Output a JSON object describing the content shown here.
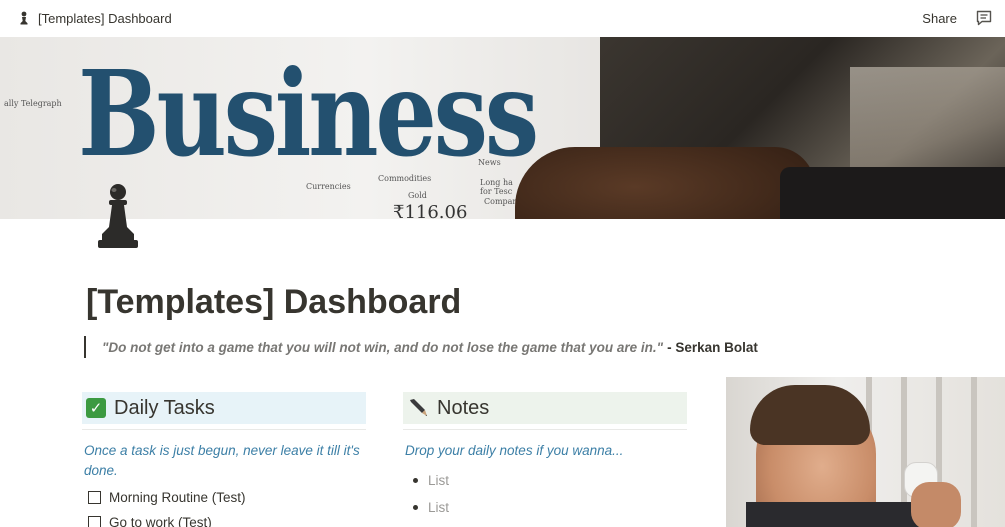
{
  "topbar": {
    "breadcrumb": "[Templates] Dashboard",
    "share_label": "Share"
  },
  "cover": {
    "headline": "Business",
    "paper_labels": [
      "ally Telegraph",
      "Currencies",
      "Commodities",
      "News",
      "Long ha",
      "for Tesc",
      "Compan",
      "Gold"
    ],
    "price": "₹116.06"
  },
  "page": {
    "title": "[Templates] Dashboard",
    "quote_text": "\"Do not get into a game that you will not win, and do not lose the game that you are in.\"",
    "quote_author": "- Serkan Bolat"
  },
  "daily_tasks": {
    "heading": "Daily Tasks",
    "subtitle": "Once a task is just begun, never leave it till it's done.",
    "items": [
      "Morning Routine (Test)",
      "Go to work (Test)"
    ]
  },
  "notes": {
    "heading": "Notes",
    "subtitle": "Drop your daily notes if you wanna...",
    "items": [
      "List",
      "List"
    ]
  },
  "colors": {
    "text": "#37352f",
    "accent_blue_text": "#3c7fa6",
    "daily_tasks_bg": "#e7f3f8",
    "notes_bg": "#edf3ec",
    "check_green": "#3c9a41"
  },
  "icons": {
    "page": "chess-pawn-icon",
    "comment": "comment-icon",
    "daily_tasks": "check-mark-icon",
    "notes": "pen-icon"
  }
}
